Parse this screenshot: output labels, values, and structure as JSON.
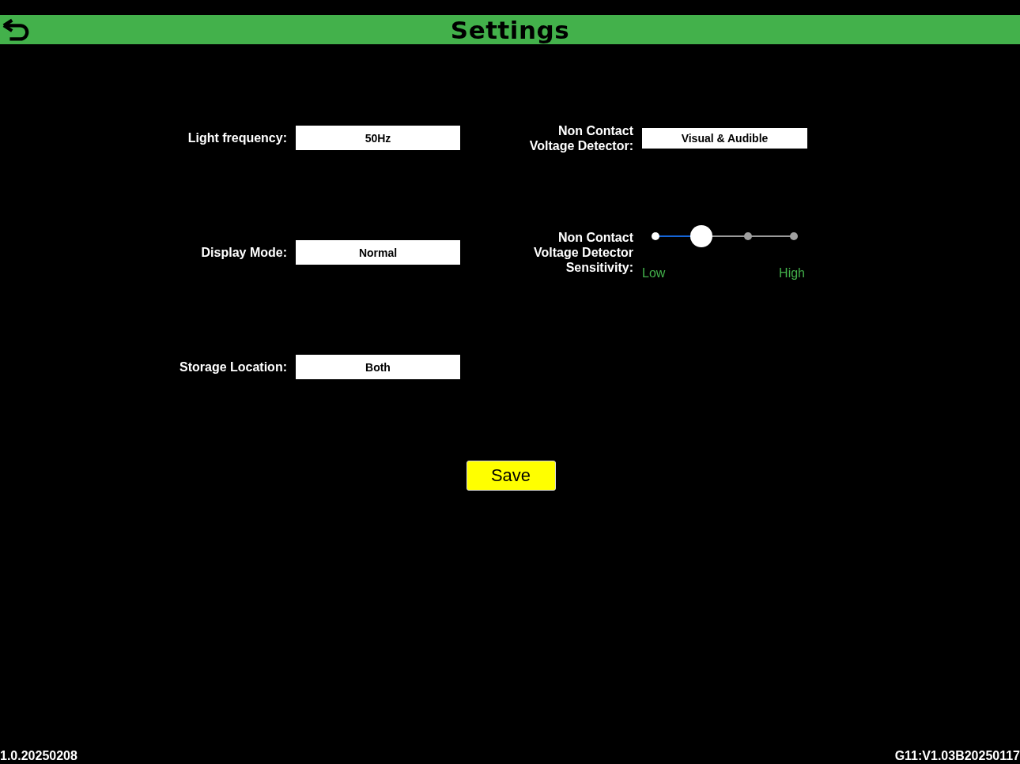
{
  "header": {
    "title": "Settings"
  },
  "settings": [
    {
      "label": "Light frequency:",
      "value": "50Hz",
      "kind": "select"
    },
    {
      "label": "Non Contact Voltage Detector:",
      "value": "Visual & Audible",
      "kind": "select"
    },
    {
      "label": "Display Mode:",
      "value": "Normal",
      "kind": "select"
    },
    {
      "label": "Non Contact Voltage Detector Sensitivity:",
      "kind": "slider",
      "level": 0.333,
      "low_label": "Low",
      "high_label": "High"
    },
    {
      "label": "Storage Location:",
      "value": "Both",
      "kind": "select"
    }
  ],
  "save_button": "Save",
  "footer": {
    "app_version": "1.0.20250208",
    "firmware_version": "G11:V1.03B20250117"
  }
}
